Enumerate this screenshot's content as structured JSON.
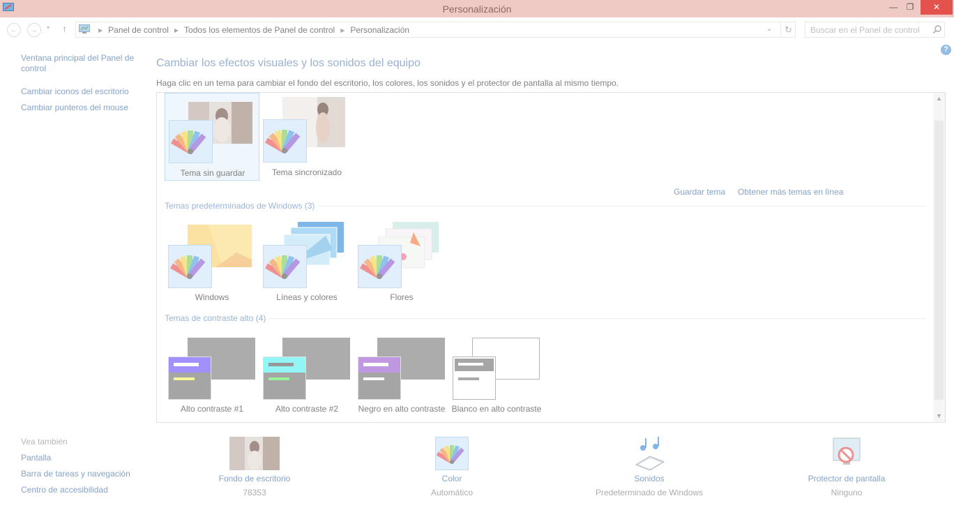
{
  "window": {
    "title": "Personalización",
    "minimize": "—",
    "maximize": "❐",
    "close": "✕"
  },
  "address_bar": {
    "back": "←",
    "forward": "→",
    "recent": "▾",
    "up": "↑",
    "breadcrumb": [
      "Panel de control",
      "Todos los elementos de Panel de control",
      "Personalización"
    ],
    "separator": "▶",
    "dropdown": "⌄",
    "refresh": "↻",
    "search_placeholder": "Buscar en el Panel de control"
  },
  "help": "?",
  "sidebar": {
    "links": [
      "Ventana principal del Panel de control",
      "Cambiar iconos del escritorio",
      "Cambiar punteros del mouse"
    ],
    "see_also_heading": "Vea también",
    "see_also": [
      "Pantalla",
      "Barra de tareas y navegación",
      "Centro de accesibilidad"
    ]
  },
  "main": {
    "title": "Cambiar los efectos visuales y los sonidos del equipo",
    "description": "Haga clic en un tema para cambiar el fondo del escritorio, los colores, los sonidos y el protector de pantalla al mismo tiempo.",
    "my_themes": [
      {
        "label": "Tema sin guardar",
        "selected": true
      },
      {
        "label": "Tema sincronizado",
        "selected": false
      }
    ],
    "save_theme": "Guardar tema",
    "more_themes": "Obtener más temas en línea",
    "default_section": "Temas predeterminados de Windows (3)",
    "default_themes": [
      "Windows",
      "Líneas y colores",
      "Flores"
    ],
    "contrast_section": "Temas de contraste alto (4)",
    "contrast_themes": [
      "Alto contraste #1",
      "Alto contraste #2",
      "Negro en alto contraste",
      "Blanco en alto contraste"
    ],
    "scroll_up": "▲",
    "scroll_down": "▼"
  },
  "bottom": {
    "wallpaper": {
      "label": "Fondo de escritorio",
      "value": "78353"
    },
    "color": {
      "label": "Color",
      "value": "Automático"
    },
    "sounds": {
      "label": "Sonidos",
      "value": "Predeterminado de Windows"
    },
    "screensaver": {
      "label": "Protector de pantalla",
      "value": "Ninguno"
    }
  },
  "colors": {
    "titlebar": "#efc9c3",
    "close": "#e3524d",
    "link": "#3b6aa5",
    "accent": "#5c82b4"
  }
}
